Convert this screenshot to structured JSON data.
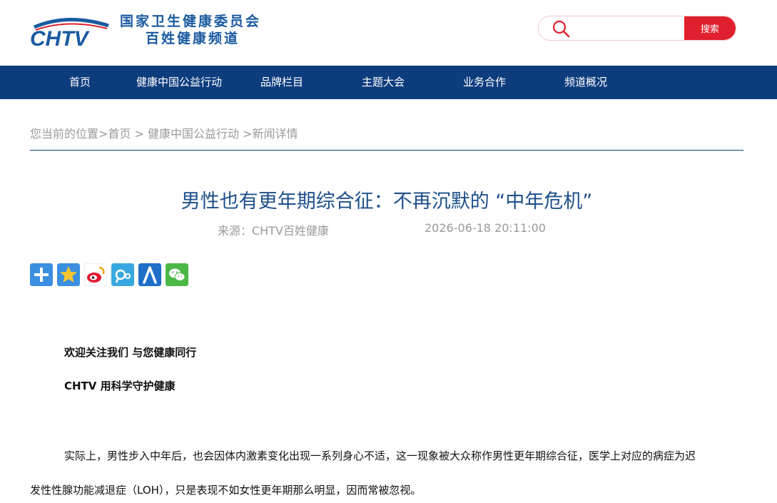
{
  "header": {
    "logo_text": "CHTV",
    "org_line1": "国家卫生健康委员会",
    "org_line2": "百姓健康频道",
    "search_placeholder": "",
    "search_button": "搜索"
  },
  "nav": {
    "items": [
      {
        "label": "首页"
      },
      {
        "label": "健康中国公益行动"
      },
      {
        "label": "品牌栏目"
      },
      {
        "label": "主题大会"
      },
      {
        "label": "业务合作"
      },
      {
        "label": "频道概况"
      }
    ]
  },
  "breadcrumb": {
    "prefix": "您当前的位置",
    "items": [
      "首页",
      "健康中国公益行动",
      "新闻详情"
    ]
  },
  "article": {
    "title": "男性也有更年期综合征：不再沉默的 “中年危机”",
    "source": "来源：CHTV百姓健康",
    "date": "2026-06-18 20:11:00",
    "intro1": "欢迎关注我们 与您健康同行",
    "intro2": "CHTV 用科学守护健康",
    "para1_line1": "实际上，男性步入中年后，也会因体内激素变化出现一系列身心不适，这一现象被大众称作男性更年期综合征，医学上对应的病症为迟",
    "para1_line2": "发性性腺功能减退症（LOH），只是表现不如女性更年期那么明显，因而常被忽视。"
  },
  "share": {
    "icons": [
      "plus-share",
      "qzone-share",
      "weibo-share",
      "tencent-weibo-share",
      "renren-share",
      "wechat-share"
    ]
  },
  "colors": {
    "nav_bg": "#0e3d7e",
    "title_blue": "#1d4f8a",
    "search_red": "#e0202e"
  }
}
